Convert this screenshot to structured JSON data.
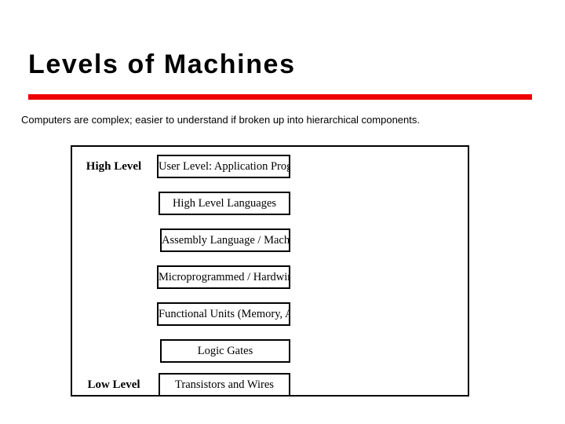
{
  "slide": {
    "title": "Levels of Machines",
    "accent_color": "#ee0000",
    "background_color": "#ffffff",
    "subtitle": "Computers are complex; easier to understand if broken up into hierarchical components."
  },
  "diagram": {
    "top_label": "High Level",
    "bottom_label": "Low Level",
    "levels": [
      {
        "label": "User Level: Application Programs"
      },
      {
        "label": "High Level Languages"
      },
      {
        "label": "Assembly Language / Machine Code"
      },
      {
        "label": "Microprogrammed / Hardwired Control"
      },
      {
        "label": "Functional Units (Memory, A.L.U., etc.)"
      },
      {
        "label": "Logic Gates"
      },
      {
        "label": "Transistors and Wires"
      }
    ]
  }
}
